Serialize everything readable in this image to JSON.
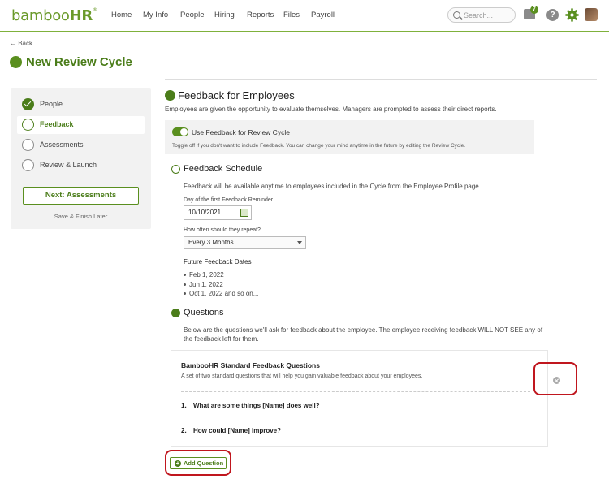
{
  "nav": {
    "logo_text": "bamboo",
    "logo_hr": "HR",
    "logo_tm": "®",
    "items": [
      "Home",
      "My Info",
      "People",
      "Hiring",
      "Reports",
      "Files",
      "Payroll"
    ],
    "search_placeholder": "Search...",
    "inbox_count": "7",
    "help_label": "?"
  },
  "header": {
    "back_label": "← Back",
    "title": "New Review Cycle"
  },
  "sidebar": {
    "steps": [
      {
        "label": "People",
        "state": "done"
      },
      {
        "label": "Feedback",
        "state": "current"
      },
      {
        "label": "Assessments",
        "state": "todo"
      },
      {
        "label": "Review & Launch",
        "state": "todo"
      }
    ],
    "next_button": "Next: Assessments",
    "save_later": "Save & Finish Later"
  },
  "main": {
    "title": "Feedback for Employees",
    "intro": "Employees are given the opportunity to evaluate themselves. Managers are prompted to assess their direct reports.",
    "toggle_label": "Use Feedback for Review Cycle",
    "toggle_help": "Toggle off if you don't want to include Feedback. You can change your mind anytime in the future by editing the Review Cycle.",
    "schedule": {
      "title": "Feedback Schedule",
      "desc": "Feedback will be available anytime to employees included in the Cycle from the Employee Profile page.",
      "first_reminder_label": "Day of the first Feedback Reminder",
      "first_reminder_value": "10/10/2021",
      "repeat_label": "How often should they repeat?",
      "repeat_value": "Every 3 Months",
      "future_label": "Future Feedback Dates",
      "future_dates": [
        "Feb 1, 2022",
        "Jun 1, 2022",
        "Oct 1, 2022 and so on..."
      ]
    },
    "questions": {
      "title": "Questions",
      "desc_line1": "Below are the questions we'll ask for feedback about the employee. The employee receiving feedback WILL NOT SEE any of",
      "desc_line2": "the feedback left for them.",
      "box_title": "BambooHR Standard Feedback Questions",
      "box_desc": "A set of two standard questions that will help you gain valuable feedback about your employees.",
      "items": [
        {
          "num": "1.",
          "text": "What are some things [Name] does well?"
        },
        {
          "num": "2.",
          "text": "How could [Name] improve?"
        }
      ],
      "add_button": "Add Question",
      "add_plus": "+"
    }
  },
  "colors": {
    "brand_green": "#4b7d1a",
    "highlight_red": "#c0161e"
  }
}
